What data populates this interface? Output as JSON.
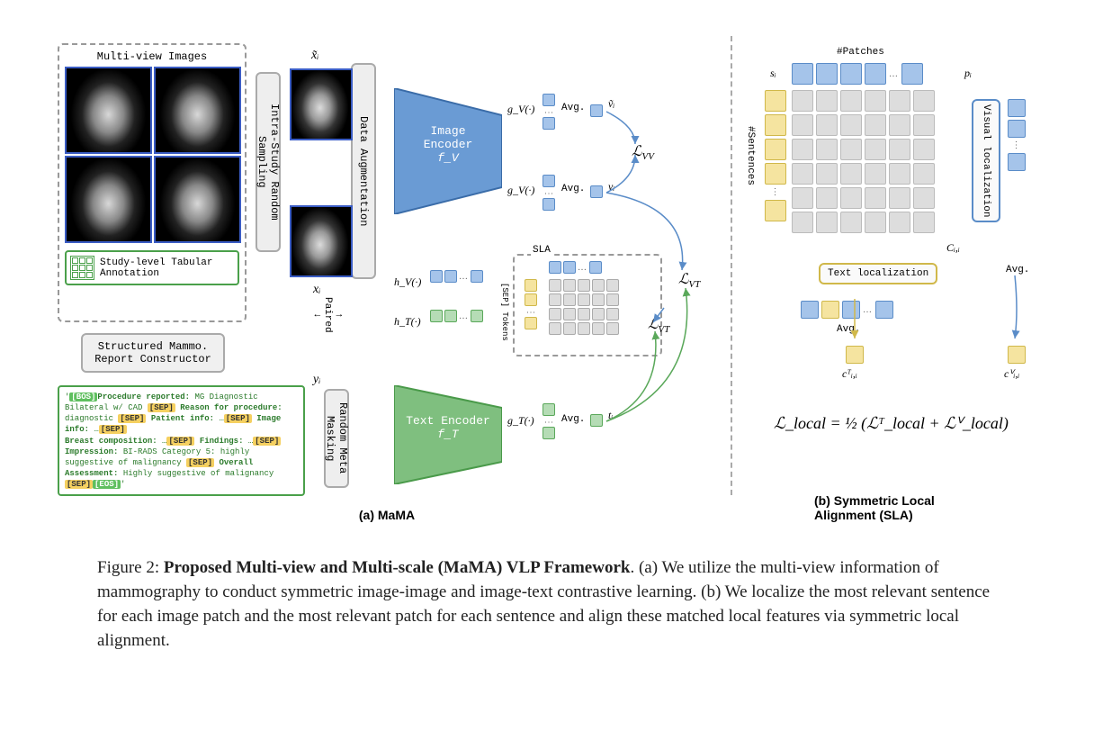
{
  "figure_label": "Figure 2",
  "figure_title": "Proposed Multi-view and Multi-scale (MaMA) VLP Framework",
  "caption_a": "(a) We utilize the multi-view information of mammography to conduct symmetric image-image and image-text contrastive learning.",
  "caption_b": "(b) We localize the most relevant sentence for each image patch and the most relevant patch for each sentence and align these matched local features via symmetric local alignment.",
  "panel_a_label": "(a) MaMA",
  "panel_b_label": "(b) Symmetric Local Alignment (SLA)",
  "mv_title": "Multi-view Images",
  "mv_annotation": "Study-level Tabular Annotation",
  "constructor": "Structured Mammo. Report Constructor",
  "report_tokens": {
    "bos": "[BOS]",
    "sep": "[SEP]",
    "eos": "[EOS]",
    "t1": "Procedure reported:",
    "v1": " MG Diagnostic Bilateral w/ CAD ",
    "t2": "Reason for procedure:",
    "v2": " diagnostic ",
    "t3": "Patient info:",
    "v3": " …",
    "t4": "Image info:",
    "v4": " …",
    "t5": "Breast composition:",
    "v5": " …",
    "t6": "Findings:",
    "v6": " …",
    "t7": "Impression:",
    "v7": " BI-RADS Category 5: highly suggestive of malignancy ",
    "t8": "Overall Assessment:",
    "v8": " Highly suggestive of malignancy "
  },
  "block_intra": "Intra-Study Random Sampling",
  "block_aug": "Data Augmentation",
  "block_mask": "Random Meta Masking",
  "x_tilde": "x̃ᵢ",
  "x_i": "xᵢ",
  "y_i": "yᵢ",
  "paired": "Paired",
  "img_encoder": "Image Encoder",
  "img_encoder_f": "f_V",
  "txt_encoder": "Text Encoder",
  "txt_encoder_f": "f_T",
  "gv": "g_V(·)",
  "gt": "g_T(·)",
  "hv": "h_V(·)",
  "ht": "h_T(·)",
  "avg": "Avg.",
  "v_tilde": "ṽᵢ",
  "v_i": "vᵢ",
  "t_i": "tᵢ",
  "sla": "SLA",
  "sep_vert": "[SEP] Tokens",
  "loss_vv": "ℒ_VV",
  "loss_vt": "ℒ_VT",
  "patches": "#Patches",
  "sentences": "#Sentences",
  "s_i": "sᵢ",
  "p_i": "pᵢ",
  "C_ii": "Cᵢ,ᵢ",
  "vis_loc": "Visual localization",
  "txt_loc": "Text localization",
  "cT": "cᵀᵢ,ᵢ",
  "cV": "cⱽᵢ,ᵢ",
  "formula": "ℒ_local = ½ (ℒᵀ_local + ℒⱽ_local)"
}
